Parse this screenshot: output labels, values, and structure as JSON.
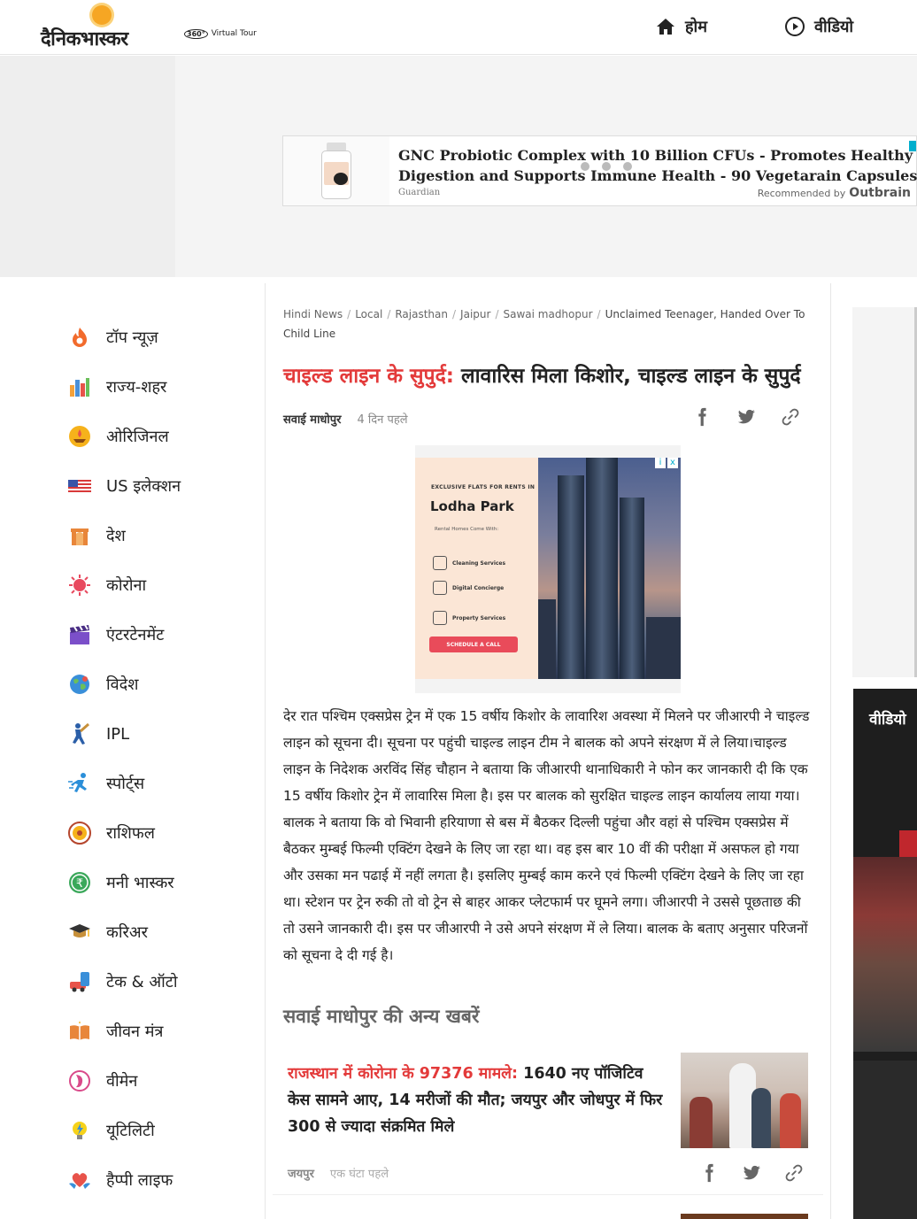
{
  "header": {
    "logo_text": "दैनिकभास्कर",
    "nav": [
      {
        "label": "होम",
        "icon": "home-icon"
      },
      {
        "label": "वीडियो",
        "icon": "play-circle-icon"
      }
    ]
  },
  "top_ad": {
    "headline": "GNC Probiotic Complex with 10 Billion CFUs - Promotes Healthy Digestion and Supports Immune Health - 90 Vegetarain Capsules",
    "source": "Guardian",
    "recommended_label": "Recommended by",
    "brand": "Outbrain",
    "ad_choice_color": "#00aecd"
  },
  "sidebar": {
    "items": [
      {
        "label": "टॉप न्यूज़",
        "icon": "flame-icon"
      },
      {
        "label": "राज्य-शहर",
        "icon": "city-icon"
      },
      {
        "label": "ओरिजिनल",
        "icon": "diya-icon"
      },
      {
        "label": "US इलेक्शन",
        "icon": "us-flag-icon"
      },
      {
        "label": "देश",
        "icon": "india-gate-icon"
      },
      {
        "label": "कोरोना",
        "icon": "virus-icon"
      },
      {
        "label": "एंटरटेनमेंट",
        "icon": "clapperboard-icon"
      },
      {
        "label": "विदेश",
        "icon": "globe-icon"
      },
      {
        "label": "IPL",
        "icon": "cricket-icon"
      },
      {
        "label": "स्पोर्ट्स",
        "icon": "runner-icon"
      },
      {
        "label": "राशिफल",
        "icon": "zodiac-icon"
      },
      {
        "label": "मनी भास्कर",
        "icon": "rupee-icon"
      },
      {
        "label": "करिअर",
        "icon": "graduation-cap-icon"
      },
      {
        "label": "टेक & ऑटो",
        "icon": "tech-auto-icon"
      },
      {
        "label": "जीवन मंत्र",
        "icon": "book-icon"
      },
      {
        "label": "वीमेन",
        "icon": "women-icon"
      },
      {
        "label": "यूटिलिटी",
        "icon": "bulb-icon"
      },
      {
        "label": "हैप्पी लाइफ",
        "icon": "heart-hands-icon"
      }
    ]
  },
  "breadcrumb": {
    "items": [
      "Hindi News",
      "Local",
      "Rajasthan",
      "Jaipur",
      "Sawai madhopur"
    ],
    "current": "Unclaimed Teenager, Handed Over To Child Line"
  },
  "article": {
    "kicker": "चाइल्ड लाइन के सुपुर्द:",
    "title": " लावारिस मिला किशोर, चाइल्ड लाइन के सुपुर्द",
    "place": "सवाई माधोपुर",
    "time": "4 दिन पहले",
    "body": "देर रात पश्चिम एक्सप्रेस ट्रेन में एक 15 वर्षीय किशोर के लावारिश अवस्था में मिलने पर जीआरपी ने चाइल्ड लाइन को सूचना दी। सूचना पर पहुंची चाइल्ड लाइन टीम ने बालक को अपने संरक्षण में ले लिया।चाइल्ड लाइन के निदेशक अरविंद सिंह चौहान ने बताया कि जीआरपी थानाधिकारी ने फोन कर जानकारी दी कि एक 15 वर्षीय किशोर ट्रेन में लावारिस मिला है। इस पर बालक को सुरक्षित चाइल्ड लाइन कार्यालय लाया गया। बालक ने बताया कि वो भिवानी हरियाणा से बस में बैठकर दिल्ली पहुंचा और वहां से पश्चिम एक्सप्रेस में बैठकर मुम्बई फिल्मी एक्टिंग देखने के लिए जा रहा था। वह इस बार 10 वीं की परीक्षा में असफल हो गया और उसका मन पढाई में नहीं लगता है। इसलिए मुम्बई काम करने एवं फिल्मी एक्टिंग देखने के लिए जा रहा था। स्टेशन पर ट्रेन रुकी तो वो ट्रेन से बाहर आकर प्लेटफार्म पर घूमने लगा। जीआरपी ने उससे पूछताछ की तो उसने जानकारी दी। इस पर जीआरपी ने उसे अपने संरक्षण में ले लिया। बालक के बताए अनुसार परिजनों को सूचना दे दी गई है।",
    "kicker_color": "#e33a3a"
  },
  "article_ad": {
    "tagline": "EXCLUSIVE FLATS FOR RENTS IN",
    "brand": "Lodha Park",
    "subhead": "Rental Homes Come With:",
    "features": [
      "Cleaning Services",
      "Digital Concierge",
      "Property Services"
    ],
    "cta": "SCHEDULE A CALL",
    "tour_badge": "360°",
    "tour_label": "Virtual Tour",
    "close_icons": [
      "i",
      "x"
    ]
  },
  "related": {
    "heading": "सवाई माधोपुर की अन्य खबरें",
    "items": [
      {
        "kicker": "राजस्थान में कोरोना के 97376 मामले:",
        "title": " 1640 नए पॉजिटिव केस सामने आए, 14 मरीजों की मौत; जयपुर और जोधपुर में फिर 300 से ज्यादा संक्रमित मिले",
        "place": "जयपुर",
        "time": "एक घंटा पहले"
      }
    ]
  },
  "right_rail": {
    "video_label": "वीडियो"
  }
}
